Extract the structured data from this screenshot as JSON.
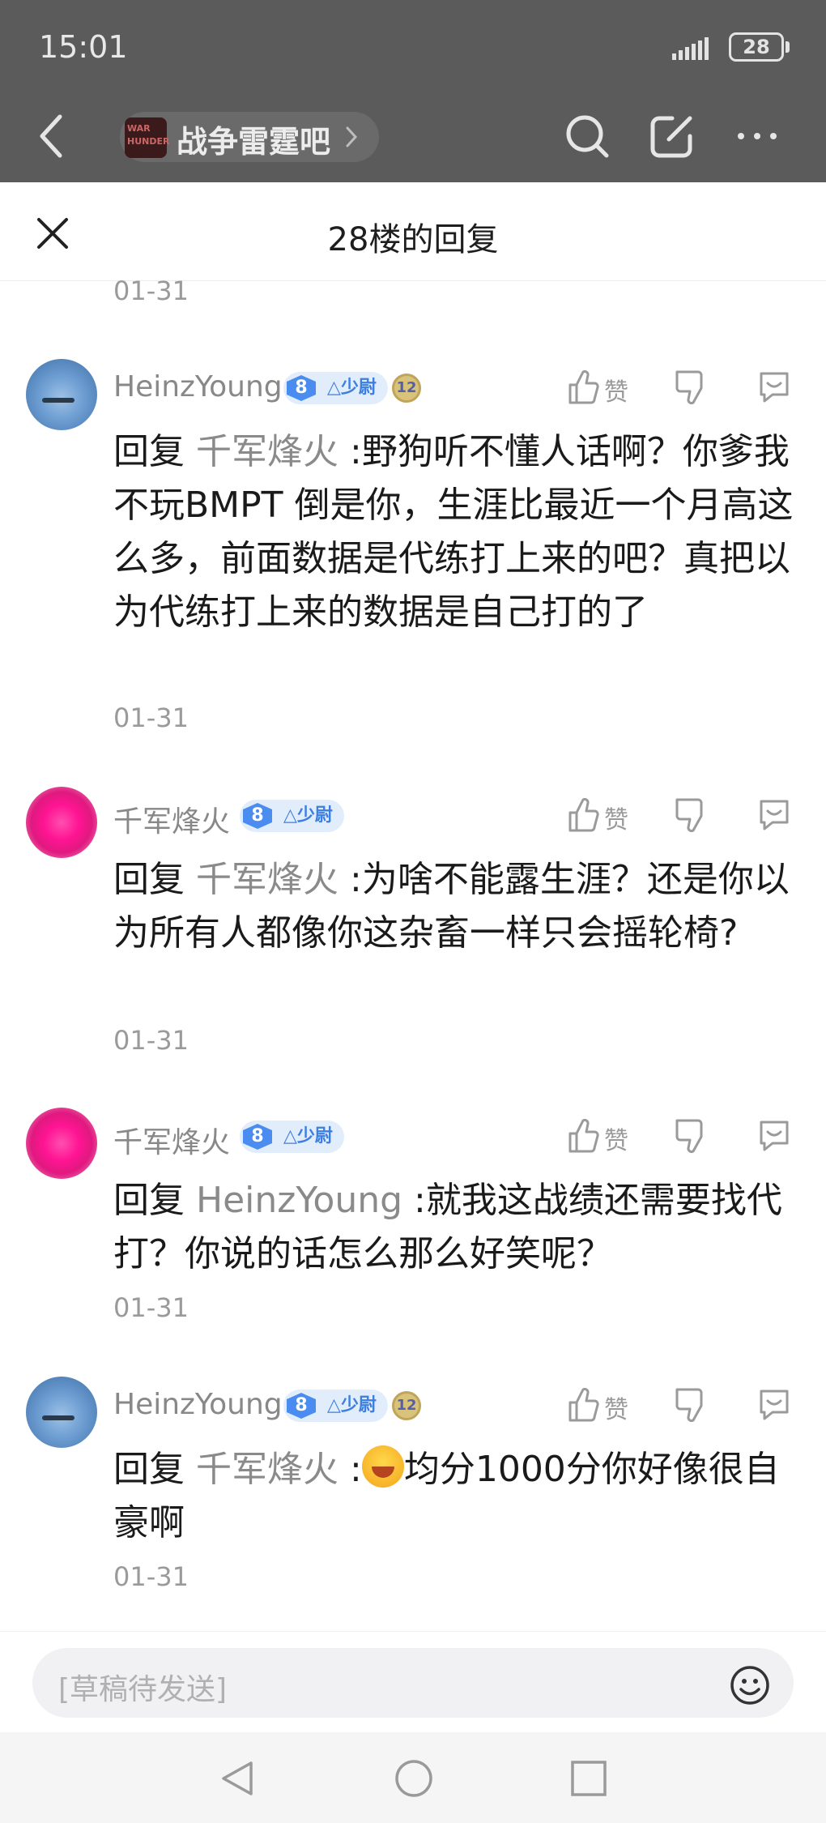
{
  "status_bar": {
    "time": "15:01",
    "battery": "28"
  },
  "app_header": {
    "forum_name": "战争雷霆吧",
    "logo_text": "WAR THUNDER"
  },
  "sheet": {
    "title": "28楼的回复",
    "top_date": "01-31"
  },
  "comments": [
    {
      "username": "HeinzYoung",
      "level": "8",
      "rank": "△少尉",
      "medal": "12",
      "like_label": "赞",
      "reply_prefix": "回复",
      "reply_target": "千军烽火",
      "text": ":野狗听不懂人话啊？你爹我不玩BMPT 倒是你，生涯比最近一个月高这么多，前面数据是代练打上来的吧？真把以为代练打上来的数据是自己打的了",
      "date": "01-31"
    },
    {
      "username": "千军烽火",
      "level": "8",
      "rank": "△少尉",
      "like_label": "赞",
      "reply_prefix": "回复",
      "reply_target": "千军烽火",
      "text": ":为啥不能露生涯？还是你以为所有人都像你这杂畜一样只会摇轮椅?",
      "date": "01-31"
    },
    {
      "username": "千军烽火",
      "level": "8",
      "rank": "△少尉",
      "like_label": "赞",
      "reply_prefix": "回复",
      "reply_target": "HeinzYoung",
      "text": ":就我这战绩还需要找代打？你说的话怎么那么好笑呢？",
      "date": "01-31"
    },
    {
      "username": "HeinzYoung",
      "level": "8",
      "rank": "△少尉",
      "medal": "12",
      "like_label": "赞",
      "reply_prefix": "回复",
      "reply_target": "千军烽火",
      "text_before_emoji": ":",
      "emoji": "sweat-smile-emoji",
      "text": "均分1000分你好像很自豪啊",
      "date": "01-31"
    }
  ],
  "input": {
    "placeholder": "[草稿待发送]"
  },
  "icons": [
    "signal-icon",
    "battery-icon",
    "back-icon",
    "search-icon",
    "edit-icon",
    "more-icon",
    "close-icon",
    "like-icon",
    "dislike-icon",
    "reply-icon",
    "emoji-icon",
    "nav-back-icon",
    "nav-home-icon",
    "nav-recent-icon"
  ]
}
